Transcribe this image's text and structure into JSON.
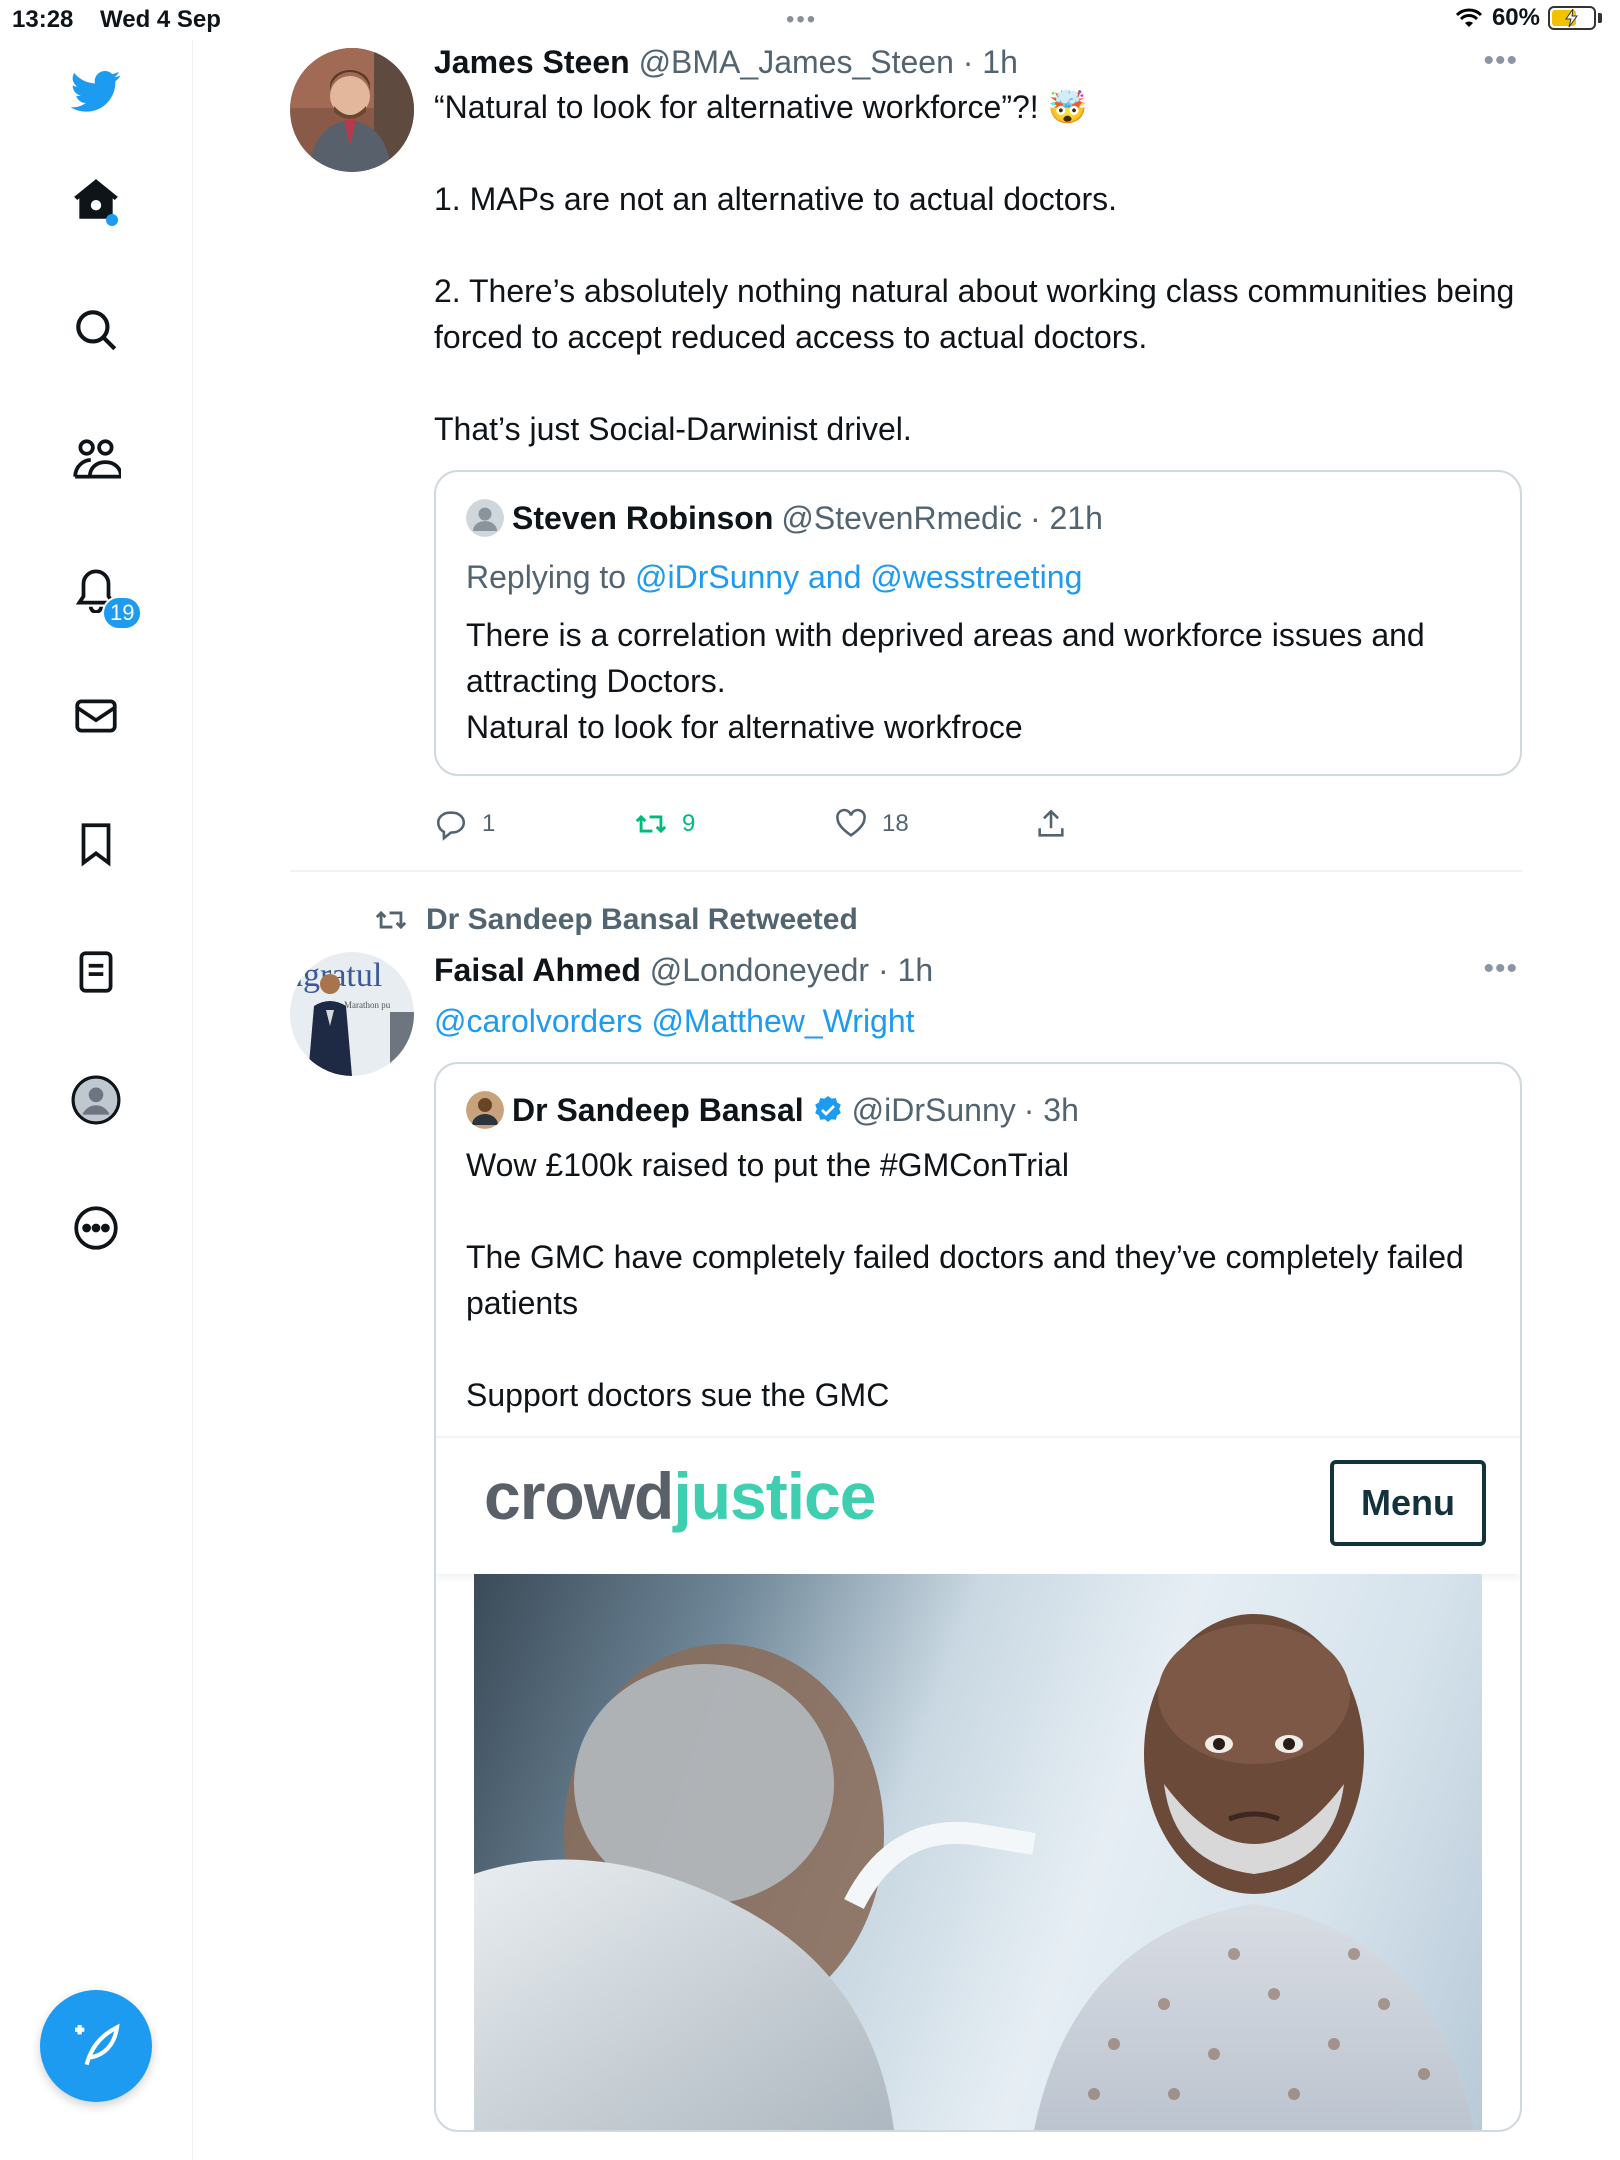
{
  "status_bar": {
    "time": "13:28",
    "date": "Wed 4 Sep",
    "battery": "60%",
    "battery_level": 0.6
  },
  "sidebar": {
    "items": [
      {
        "icon": "twitter-logo-icon"
      },
      {
        "icon": "home-icon"
      },
      {
        "icon": "search-icon"
      },
      {
        "icon": "communities-icon"
      },
      {
        "icon": "notifications-icon",
        "badge": "19"
      },
      {
        "icon": "messages-icon"
      },
      {
        "icon": "bookmarks-icon"
      },
      {
        "icon": "lists-icon"
      },
      {
        "icon": "profile-icon"
      },
      {
        "icon": "more-icon"
      }
    ],
    "compose_icon": "compose-icon"
  },
  "colors": {
    "accent": "#1d9bf0",
    "retweet_green": "#00ba7c",
    "muted": "#536471",
    "crowdjustice_teal": "#3ecfb0"
  },
  "tweets": [
    {
      "name": "James Steen",
      "handle": "@BMA_James_Steen",
      "time": "· 1h",
      "text": "“Natural to look for alternative workforce”?! 🤯\n\n1. MAPs are not an alternative to actual doctors.\n\n2. There’s absolutely nothing natural about working class communities being forced to accept reduced access to actual doctors.\n\nThat’s just Social-Darwinist drivel.",
      "quote": {
        "name": "Steven Robinson",
        "handle": "@StevenRmedic",
        "time": "· 21h",
        "replying_prefix": "Replying to ",
        "replying_to": "@iDrSunny and @wesstreeting",
        "text": "There is a correlation with deprived areas and workforce issues and attracting Doctors.\nNatural to look for alternative workfroce"
      },
      "actions": {
        "replies": "1",
        "retweets": "9",
        "likes": "18"
      }
    },
    {
      "retweeted_by": "Dr Sandeep Bansal Retweeted",
      "name": "Faisal Ahmed",
      "handle": "@Londoneyedr",
      "time": "· 1h",
      "mentions": "@carolvorders @Matthew_Wright",
      "quote": {
        "name": "Dr Sandeep Bansal",
        "handle": "@iDrSunny",
        "time": "· 3h",
        "verified": true,
        "text": "Wow £100k raised to put the #GMConTrial\n\nThe GMC have completely failed doctors and they’ve completely failed patients\n\nSupport doctors sue the GMC",
        "card": {
          "logo_part1": "crowd",
          "logo_part2": "justice",
          "menu_label": "Menu"
        }
      }
    }
  ]
}
